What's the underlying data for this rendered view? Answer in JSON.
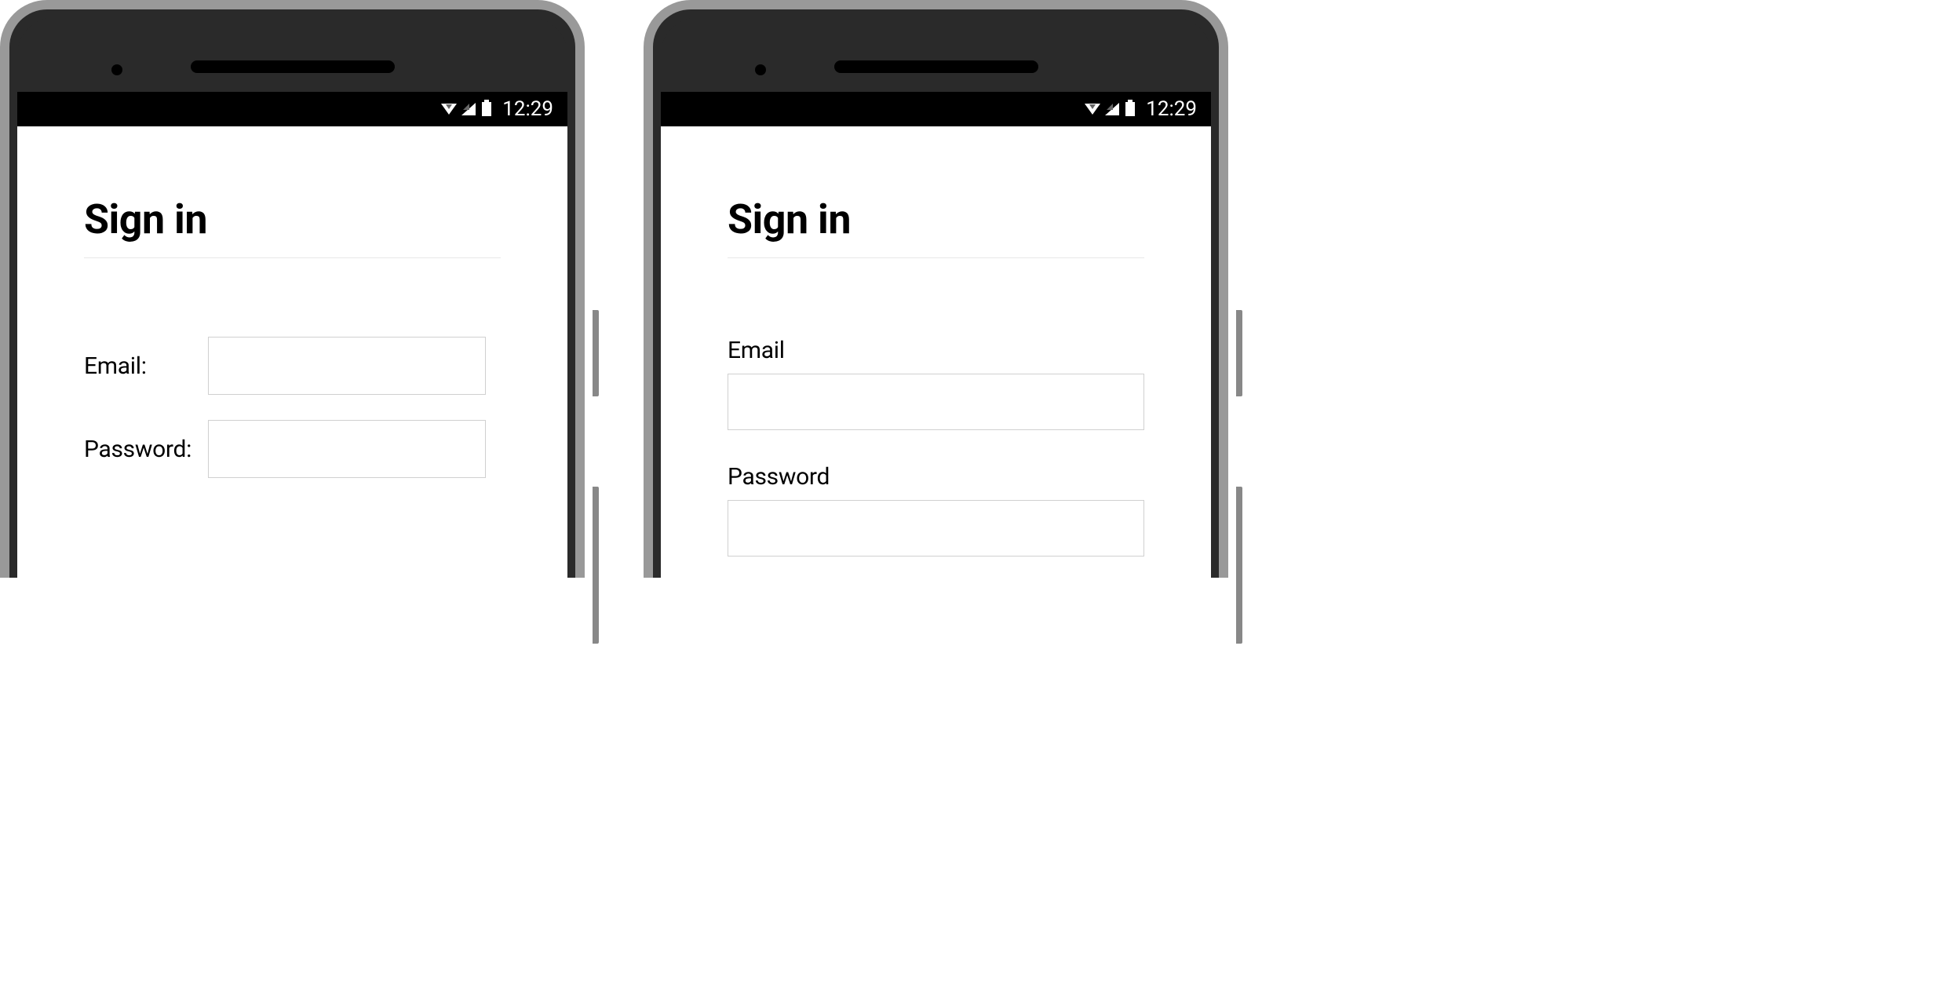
{
  "status_bar": {
    "time": "12:29"
  },
  "phone_a": {
    "title": "Sign in",
    "email_label": "Email:",
    "password_label": "Password:"
  },
  "phone_b": {
    "title": "Sign in",
    "email_label": "Email",
    "password_label": "Password"
  }
}
